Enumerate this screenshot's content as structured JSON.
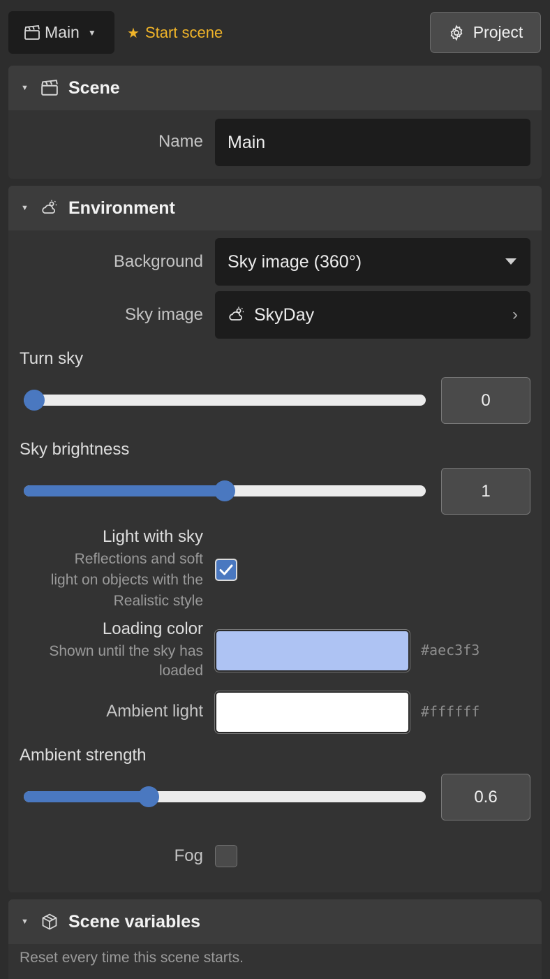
{
  "topbar": {
    "scene_name": "Main",
    "start_scene_label": "Start scene",
    "project_label": "Project"
  },
  "scene_panel": {
    "title": "Scene",
    "name_label": "Name",
    "name_value": "Main"
  },
  "environment_panel": {
    "title": "Environment",
    "background_label": "Background",
    "background_value": "Sky image (360°)",
    "sky_image_label": "Sky image",
    "sky_image_value": "SkyDay",
    "turn_sky_label": "Turn sky",
    "turn_sky_value": "0",
    "turn_sky_fraction": 0.0,
    "sky_brightness_label": "Sky brightness",
    "sky_brightness_value": "1",
    "sky_brightness_fraction": 0.5,
    "light_with_sky_label": "Light with sky",
    "light_with_sky_desc": [
      "Reflections and soft",
      "light on objects with the",
      "Realistic style"
    ],
    "light_with_sky_checked": true,
    "loading_color_label": "Loading color",
    "loading_color_desc": [
      "Shown until the sky has",
      "loaded"
    ],
    "loading_color_hex": "#aec3f3",
    "ambient_light_label": "Ambient light",
    "ambient_light_hex": "#ffffff",
    "ambient_strength_label": "Ambient strength",
    "ambient_strength_value": "0.6",
    "ambient_strength_fraction": 0.3,
    "fog_label": "Fog",
    "fog_checked": false
  },
  "variables_panel": {
    "title": "Scene variables",
    "description": "Reset every time this scene starts."
  },
  "colors": {
    "accent": "#4a78c0",
    "star": "#f0b429"
  }
}
